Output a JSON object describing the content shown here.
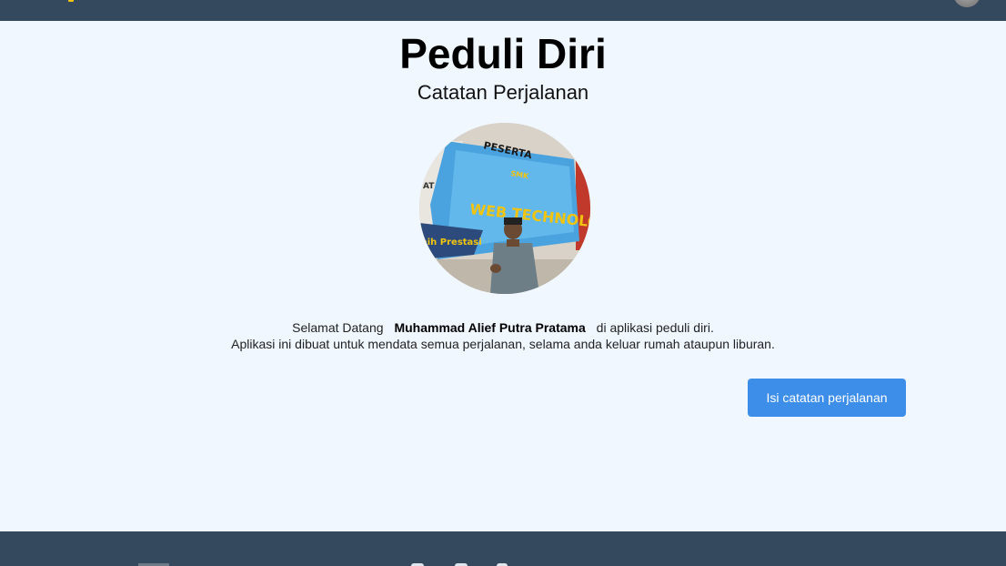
{
  "header": {
    "accent_color": "#f1c40f",
    "user_avatar": "user-avatar-icon"
  },
  "hero": {
    "title": "Peduli Diri",
    "subtitle": "Catatan Perjalanan",
    "photo": {
      "banner_line1": "PESERTA",
      "banner_line2": "SMK",
      "banner_line3": "WEB TECHNOLOGIES",
      "banner_bottom": "aih Prestasi",
      "banner_left": "AT"
    }
  },
  "welcome": {
    "prefix": "Selamat Datang",
    "user_name": "Muhammad Alief Putra Pratama",
    "suffix": "di aplikasi peduli diri.",
    "description": "Aplikasi ini dibuat untuk mendata semua perjalanan, selama anda keluar rumah ataupun liburan."
  },
  "actions": {
    "fill_journal_label": "Isi catatan perjalanan"
  },
  "colors": {
    "nav_bg": "#34495e",
    "page_bg": "#f0f7ff",
    "button_bg": "#3d8ee8"
  }
}
